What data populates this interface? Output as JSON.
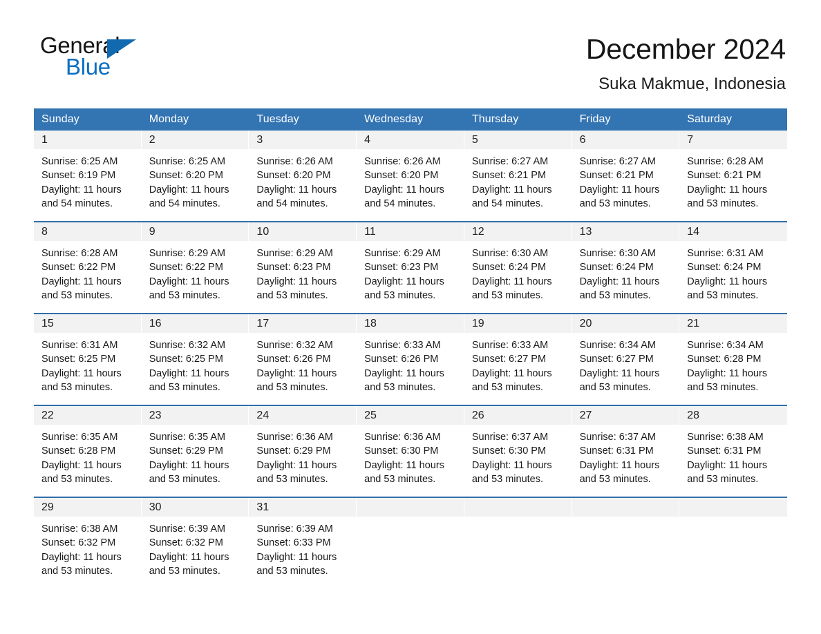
{
  "brand": {
    "name_top": "General",
    "name_bottom": "Blue",
    "triangle_color": "#1169b0",
    "text_color_top": "#161616",
    "text_color_bottom": "#0b6fc1"
  },
  "header": {
    "title": "December 2024",
    "location": "Suka Makmue, Indonesia"
  },
  "theme": {
    "header_blue": "#3374b3",
    "row_rule_blue": "#2f6fad",
    "daynum_band": "#f2f2f2",
    "page_background": "#ffffff",
    "text": "#1a1a1a"
  },
  "weekdays": [
    "Sunday",
    "Monday",
    "Tuesday",
    "Wednesday",
    "Thursday",
    "Friday",
    "Saturday"
  ],
  "weeks": [
    [
      {
        "day": "1",
        "sunrise": "Sunrise: 6:25 AM",
        "sunset": "Sunset: 6:19 PM",
        "daylight_line1": "Daylight: 11 hours",
        "daylight_line2": "and 54 minutes."
      },
      {
        "day": "2",
        "sunrise": "Sunrise: 6:25 AM",
        "sunset": "Sunset: 6:20 PM",
        "daylight_line1": "Daylight: 11 hours",
        "daylight_line2": "and 54 minutes."
      },
      {
        "day": "3",
        "sunrise": "Sunrise: 6:26 AM",
        "sunset": "Sunset: 6:20 PM",
        "daylight_line1": "Daylight: 11 hours",
        "daylight_line2": "and 54 minutes."
      },
      {
        "day": "4",
        "sunrise": "Sunrise: 6:26 AM",
        "sunset": "Sunset: 6:20 PM",
        "daylight_line1": "Daylight: 11 hours",
        "daylight_line2": "and 54 minutes."
      },
      {
        "day": "5",
        "sunrise": "Sunrise: 6:27 AM",
        "sunset": "Sunset: 6:21 PM",
        "daylight_line1": "Daylight: 11 hours",
        "daylight_line2": "and 54 minutes."
      },
      {
        "day": "6",
        "sunrise": "Sunrise: 6:27 AM",
        "sunset": "Sunset: 6:21 PM",
        "daylight_line1": "Daylight: 11 hours",
        "daylight_line2": "and 53 minutes."
      },
      {
        "day": "7",
        "sunrise": "Sunrise: 6:28 AM",
        "sunset": "Sunset: 6:21 PM",
        "daylight_line1": "Daylight: 11 hours",
        "daylight_line2": "and 53 minutes."
      }
    ],
    [
      {
        "day": "8",
        "sunrise": "Sunrise: 6:28 AM",
        "sunset": "Sunset: 6:22 PM",
        "daylight_line1": "Daylight: 11 hours",
        "daylight_line2": "and 53 minutes."
      },
      {
        "day": "9",
        "sunrise": "Sunrise: 6:29 AM",
        "sunset": "Sunset: 6:22 PM",
        "daylight_line1": "Daylight: 11 hours",
        "daylight_line2": "and 53 minutes."
      },
      {
        "day": "10",
        "sunrise": "Sunrise: 6:29 AM",
        "sunset": "Sunset: 6:23 PM",
        "daylight_line1": "Daylight: 11 hours",
        "daylight_line2": "and 53 minutes."
      },
      {
        "day": "11",
        "sunrise": "Sunrise: 6:29 AM",
        "sunset": "Sunset: 6:23 PM",
        "daylight_line1": "Daylight: 11 hours",
        "daylight_line2": "and 53 minutes."
      },
      {
        "day": "12",
        "sunrise": "Sunrise: 6:30 AM",
        "sunset": "Sunset: 6:24 PM",
        "daylight_line1": "Daylight: 11 hours",
        "daylight_line2": "and 53 minutes."
      },
      {
        "day": "13",
        "sunrise": "Sunrise: 6:30 AM",
        "sunset": "Sunset: 6:24 PM",
        "daylight_line1": "Daylight: 11 hours",
        "daylight_line2": "and 53 minutes."
      },
      {
        "day": "14",
        "sunrise": "Sunrise: 6:31 AM",
        "sunset": "Sunset: 6:24 PM",
        "daylight_line1": "Daylight: 11 hours",
        "daylight_line2": "and 53 minutes."
      }
    ],
    [
      {
        "day": "15",
        "sunrise": "Sunrise: 6:31 AM",
        "sunset": "Sunset: 6:25 PM",
        "daylight_line1": "Daylight: 11 hours",
        "daylight_line2": "and 53 minutes."
      },
      {
        "day": "16",
        "sunrise": "Sunrise: 6:32 AM",
        "sunset": "Sunset: 6:25 PM",
        "daylight_line1": "Daylight: 11 hours",
        "daylight_line2": "and 53 minutes."
      },
      {
        "day": "17",
        "sunrise": "Sunrise: 6:32 AM",
        "sunset": "Sunset: 6:26 PM",
        "daylight_line1": "Daylight: 11 hours",
        "daylight_line2": "and 53 minutes."
      },
      {
        "day": "18",
        "sunrise": "Sunrise: 6:33 AM",
        "sunset": "Sunset: 6:26 PM",
        "daylight_line1": "Daylight: 11 hours",
        "daylight_line2": "and 53 minutes."
      },
      {
        "day": "19",
        "sunrise": "Sunrise: 6:33 AM",
        "sunset": "Sunset: 6:27 PM",
        "daylight_line1": "Daylight: 11 hours",
        "daylight_line2": "and 53 minutes."
      },
      {
        "day": "20",
        "sunrise": "Sunrise: 6:34 AM",
        "sunset": "Sunset: 6:27 PM",
        "daylight_line1": "Daylight: 11 hours",
        "daylight_line2": "and 53 minutes."
      },
      {
        "day": "21",
        "sunrise": "Sunrise: 6:34 AM",
        "sunset": "Sunset: 6:28 PM",
        "daylight_line1": "Daylight: 11 hours",
        "daylight_line2": "and 53 minutes."
      }
    ],
    [
      {
        "day": "22",
        "sunrise": "Sunrise: 6:35 AM",
        "sunset": "Sunset: 6:28 PM",
        "daylight_line1": "Daylight: 11 hours",
        "daylight_line2": "and 53 minutes."
      },
      {
        "day": "23",
        "sunrise": "Sunrise: 6:35 AM",
        "sunset": "Sunset: 6:29 PM",
        "daylight_line1": "Daylight: 11 hours",
        "daylight_line2": "and 53 minutes."
      },
      {
        "day": "24",
        "sunrise": "Sunrise: 6:36 AM",
        "sunset": "Sunset: 6:29 PM",
        "daylight_line1": "Daylight: 11 hours",
        "daylight_line2": "and 53 minutes."
      },
      {
        "day": "25",
        "sunrise": "Sunrise: 6:36 AM",
        "sunset": "Sunset: 6:30 PM",
        "daylight_line1": "Daylight: 11 hours",
        "daylight_line2": "and 53 minutes."
      },
      {
        "day": "26",
        "sunrise": "Sunrise: 6:37 AM",
        "sunset": "Sunset: 6:30 PM",
        "daylight_line1": "Daylight: 11 hours",
        "daylight_line2": "and 53 minutes."
      },
      {
        "day": "27",
        "sunrise": "Sunrise: 6:37 AM",
        "sunset": "Sunset: 6:31 PM",
        "daylight_line1": "Daylight: 11 hours",
        "daylight_line2": "and 53 minutes."
      },
      {
        "day": "28",
        "sunrise": "Sunrise: 6:38 AM",
        "sunset": "Sunset: 6:31 PM",
        "daylight_line1": "Daylight: 11 hours",
        "daylight_line2": "and 53 minutes."
      }
    ],
    [
      {
        "day": "29",
        "sunrise": "Sunrise: 6:38 AM",
        "sunset": "Sunset: 6:32 PM",
        "daylight_line1": "Daylight: 11 hours",
        "daylight_line2": "and 53 minutes."
      },
      {
        "day": "30",
        "sunrise": "Sunrise: 6:39 AM",
        "sunset": "Sunset: 6:32 PM",
        "daylight_line1": "Daylight: 11 hours",
        "daylight_line2": "and 53 minutes."
      },
      {
        "day": "31",
        "sunrise": "Sunrise: 6:39 AM",
        "sunset": "Sunset: 6:33 PM",
        "daylight_line1": "Daylight: 11 hours",
        "daylight_line2": "and 53 minutes."
      },
      {
        "day": "",
        "sunrise": "",
        "sunset": "",
        "daylight_line1": "",
        "daylight_line2": ""
      },
      {
        "day": "",
        "sunrise": "",
        "sunset": "",
        "daylight_line1": "",
        "daylight_line2": ""
      },
      {
        "day": "",
        "sunrise": "",
        "sunset": "",
        "daylight_line1": "",
        "daylight_line2": ""
      },
      {
        "day": "",
        "sunrise": "",
        "sunset": "",
        "daylight_line1": "",
        "daylight_line2": ""
      }
    ]
  ]
}
